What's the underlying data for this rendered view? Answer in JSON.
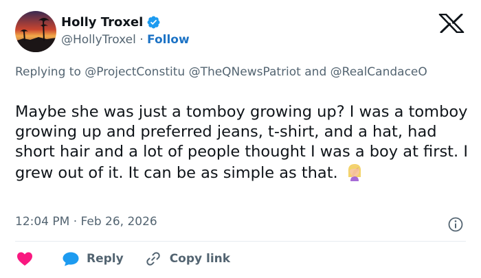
{
  "author": {
    "display_name": "Holly Troxel",
    "handle": "@HollyTroxel",
    "separator": "·",
    "follow_label": "Follow",
    "verified": true
  },
  "brand": {
    "logo": "x-logo-icon"
  },
  "reply_context": {
    "prefix": "Replying to",
    "mentions": [
      "@ProjectConstitu",
      "@TheQNewsPatriot",
      "@RealCandaceO"
    ],
    "conjunction": "and"
  },
  "tweet": {
    "text": "Maybe she was just a tomboy growing up?  I was a tomboy growing up and preferred jeans, t-shirt, and a hat, had short hair and a lot of people thought I was a boy at first.  I grew out of it.  It can be as simple as that.",
    "emoji": "woman-facepalming-emoji"
  },
  "meta": {
    "time": "12:04 PM",
    "separator": "·",
    "date": "Feb 26, 2026"
  },
  "actions": {
    "reply_label": "Reply",
    "copy_link_label": "Copy link"
  },
  "colors": {
    "link": "#1d73c5",
    "verified": "#1d9bf0",
    "heart": "#f91880",
    "reply_bubble": "#1d9bf0",
    "secondary_text": "#536471",
    "primary_text": "#0f1419",
    "divider": "#e6ecf0"
  }
}
